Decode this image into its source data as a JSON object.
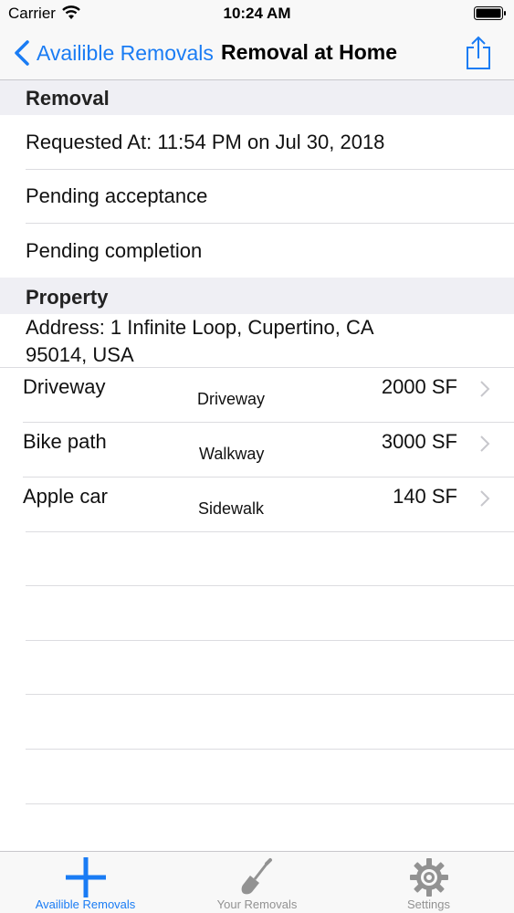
{
  "status_bar": {
    "carrier": "Carrier",
    "time": "10:24 AM"
  },
  "nav": {
    "back_label": "Availible Removals",
    "title": "Removal at Home",
    "accent_color": "#1a7cf4"
  },
  "removal_section": {
    "header": "Removal",
    "requested_at": "Requested At: 11:54 PM on Jul 30, 2018",
    "status_1": "Pending acceptance",
    "status_2": "Pending completion"
  },
  "property_section": {
    "header": "Property",
    "address_line1": "Address: 1 Infinite Loop, Cupertino, CA",
    "address_line2": "95014, USA",
    "items": [
      {
        "name": "Driveway",
        "type": "Driveway",
        "area": "2000 SF"
      },
      {
        "name": "Bike path",
        "type": "Walkway",
        "area": "3000 SF"
      },
      {
        "name": "Apple car",
        "type": "Sidewalk",
        "area": "140 SF"
      }
    ]
  },
  "tabs": [
    {
      "label": "Availible Removals",
      "icon": "plus-icon",
      "selected": true
    },
    {
      "label": "Your Removals",
      "icon": "shovel-icon",
      "selected": false
    },
    {
      "label": "Settings",
      "icon": "gear-icon",
      "selected": false
    }
  ]
}
